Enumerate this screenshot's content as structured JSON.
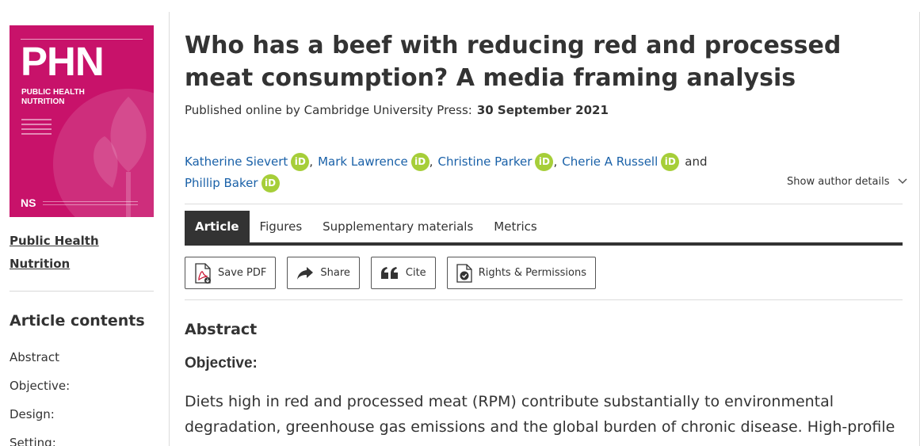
{
  "journal": {
    "cover": {
      "acronym": "PHN",
      "line1": "PUBLIC HEALTH",
      "line2": "NUTRITION",
      "publisher_mark": "NS",
      "background": "#c8126a"
    },
    "name_line1": "Public Health",
    "name_line2": "Nutrition"
  },
  "sidebar": {
    "contents_title": "Article contents",
    "items": [
      "Abstract",
      "Objective:",
      "Design:",
      "Setting:"
    ]
  },
  "article": {
    "title": "Who has a beef with reducing red and processed meat consumption? A media framing analysis",
    "published_label": "Published online by Cambridge University Press:",
    "published_date": "30 September 2021",
    "authors": [
      {
        "name": "Katherine Sievert"
      },
      {
        "name": "Mark Lawrence"
      },
      {
        "name": "Christine Parker"
      },
      {
        "name": "Cherie A Russell"
      },
      {
        "name": "Phillip Baker"
      }
    ],
    "and_word": "and",
    "orcid_label": "iD",
    "show_details": "Show author details",
    "tabs": [
      "Article",
      "Figures",
      "Supplementary materials",
      "Metrics"
    ],
    "actions": {
      "save_pdf": "Save PDF",
      "share": "Share",
      "cite": "Cite",
      "rights": "Rights & Permissions"
    },
    "abstract_heading": "Abstract",
    "objective_heading": "Objective:",
    "abstract_text": "Diets high in red and processed meat (RPM) contribute substantially to environmental degradation, greenhouse gas emissions and the global burden of chronic disease. High-profile"
  },
  "colors": {
    "link": "#1a61a8",
    "orcid": "#a6ce39",
    "tab_active": "#333333"
  }
}
